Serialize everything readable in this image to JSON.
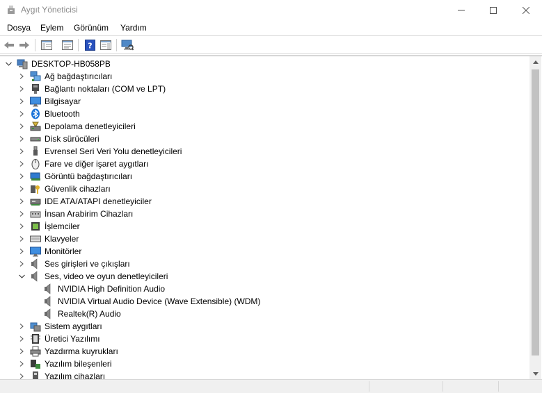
{
  "window": {
    "title": "Aygıt Yöneticisi"
  },
  "menu": [
    "Dosya",
    "Eylem",
    "Görünüm",
    "Yardım"
  ],
  "toolbar": {
    "icons": [
      "back-arrow-icon",
      "forward-arrow-icon",
      "show-hide-tree-icon",
      "properties-icon",
      "help-icon",
      "action-pane-icon",
      "scan-hardware-icon"
    ]
  },
  "tree": {
    "root": {
      "label": "DESKTOP-HB058PB",
      "expanded": true,
      "icon": "computer-icon"
    },
    "items": [
      {
        "label": "Ağ bağdaştırıcıları",
        "icon": "network-adapter-icon",
        "expanded": false
      },
      {
        "label": "Bağlantı noktaları (COM ve LPT)",
        "icon": "port-icon",
        "expanded": false
      },
      {
        "label": "Bilgisayar",
        "icon": "monitor-icon",
        "expanded": false
      },
      {
        "label": "Bluetooth",
        "icon": "bluetooth-icon",
        "expanded": false
      },
      {
        "label": "Depolama denetleyicileri",
        "icon": "storage-controller-icon",
        "expanded": false
      },
      {
        "label": "Disk sürücüleri",
        "icon": "disk-drive-icon",
        "expanded": false
      },
      {
        "label": "Evrensel Seri Veri Yolu denetleyicileri",
        "icon": "usb-icon",
        "expanded": false
      },
      {
        "label": "Fare ve diğer işaret aygıtları",
        "icon": "mouse-icon",
        "expanded": false
      },
      {
        "label": "Görüntü bağdaştırıcıları",
        "icon": "display-adapter-icon",
        "expanded": false
      },
      {
        "label": "Güvenlik cihazları",
        "icon": "security-device-icon",
        "expanded": false
      },
      {
        "label": "IDE ATA/ATAPI denetleyiciler",
        "icon": "ide-controller-icon",
        "expanded": false
      },
      {
        "label": "İnsan Arabirim Cihazları",
        "icon": "hid-icon",
        "expanded": false
      },
      {
        "label": "İşlemciler",
        "icon": "processor-icon",
        "expanded": false
      },
      {
        "label": "Klavyeler",
        "icon": "keyboard-icon",
        "expanded": false
      },
      {
        "label": "Monitörler",
        "icon": "monitor-icon",
        "expanded": false
      },
      {
        "label": "Ses girişleri ve çıkışları",
        "icon": "speaker-icon",
        "expanded": false
      },
      {
        "label": "Ses, video ve oyun denetleyicileri",
        "icon": "speaker-icon",
        "expanded": true,
        "children": [
          {
            "label": "NVIDIA High Definition Audio",
            "icon": "speaker-icon"
          },
          {
            "label": "NVIDIA Virtual Audio Device (Wave Extensible) (WDM)",
            "icon": "speaker-icon"
          },
          {
            "label": "Realtek(R) Audio",
            "icon": "speaker-icon"
          }
        ]
      },
      {
        "label": "Sistem aygıtları",
        "icon": "system-device-icon",
        "expanded": false
      },
      {
        "label": "Üretici Yazılımı",
        "icon": "firmware-icon",
        "expanded": false
      },
      {
        "label": "Yazdırma kuyrukları",
        "icon": "printer-icon",
        "expanded": false
      },
      {
        "label": "Yazılım bileşenleri",
        "icon": "software-component-icon",
        "expanded": false
      },
      {
        "label": "Yazılım cihazları",
        "icon": "software-device-icon",
        "expanded": false
      }
    ]
  }
}
